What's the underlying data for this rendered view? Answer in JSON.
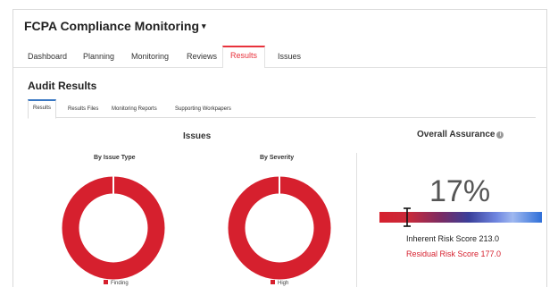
{
  "app": {
    "title": "FCPA Compliance Monitoring",
    "title_caret": "▾"
  },
  "nav": {
    "tabs": [
      {
        "label": "Dashboard"
      },
      {
        "label": "Planning"
      },
      {
        "label": "Monitoring"
      },
      {
        "label": "Reviews"
      },
      {
        "label": "Results",
        "active": true
      },
      {
        "label": "Issues"
      }
    ]
  },
  "page": {
    "title": "Audit Results",
    "subtabs": [
      {
        "label": "Results",
        "active": true
      },
      {
        "label": "Results Files"
      },
      {
        "label": "Monitoring Reports"
      },
      {
        "label": "Supporting Workpapers"
      }
    ]
  },
  "issues": {
    "title": "Issues",
    "by_type": {
      "title": "By Issue Type",
      "legend": "Finding"
    },
    "by_severity": {
      "title": "By Severity",
      "legend": "High"
    }
  },
  "assurance": {
    "title": "Overall Assurance",
    "info_icon": "i",
    "percent": "17%",
    "marker_position": 0.17,
    "inherent": "Inherent Risk Score 213.0",
    "residual": "Residual Risk Score 177.0"
  },
  "colors": {
    "accent_red": "#d6202e",
    "accent_blue": "#3a78c3"
  }
}
